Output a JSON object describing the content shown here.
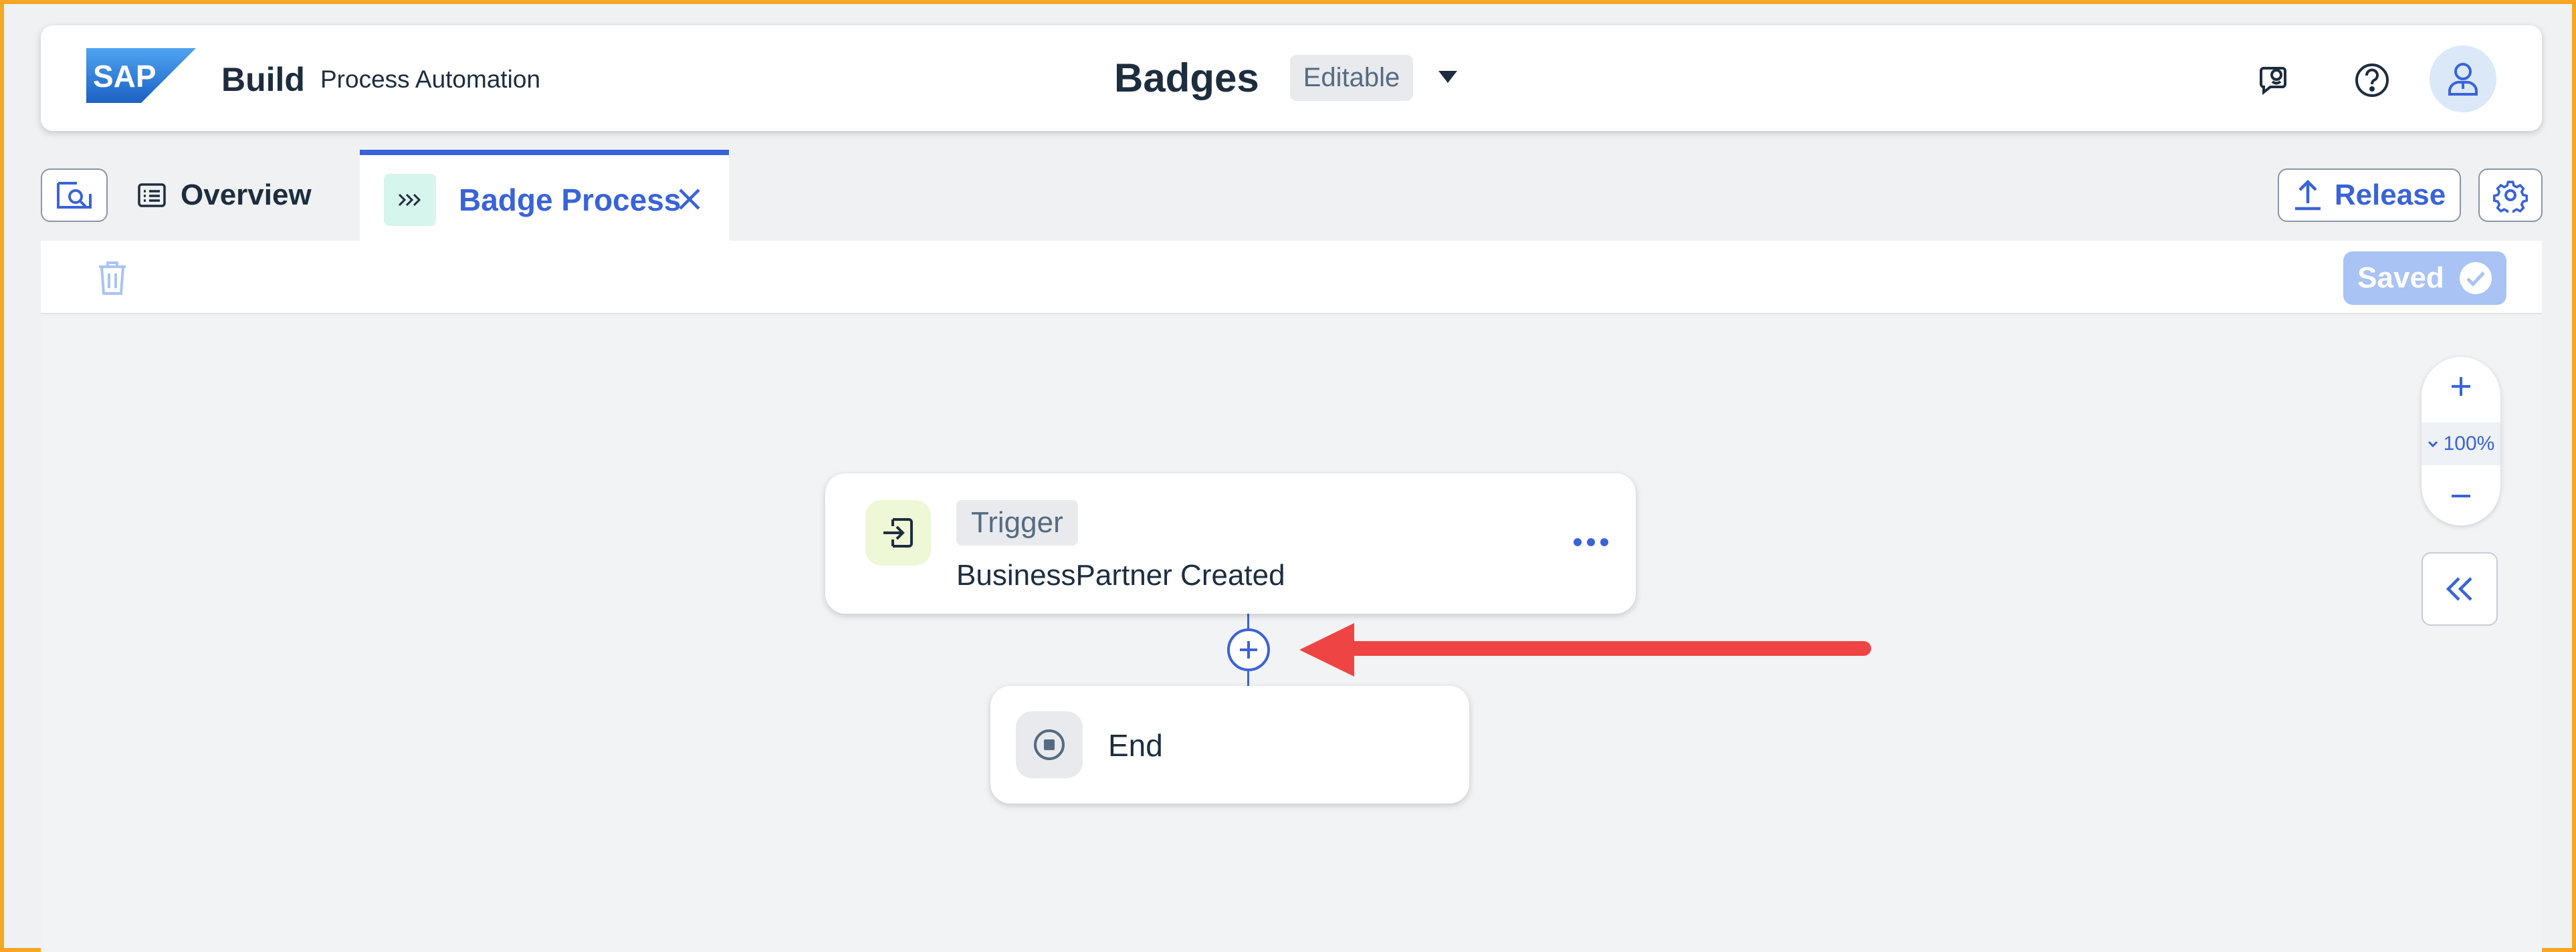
{
  "shellbar": {
    "logo_text": "SAP",
    "product": "Build",
    "subproduct": "Process Automation",
    "title": "Badges",
    "status_tag": "Editable",
    "icons": [
      "joule-assistant-icon",
      "help-icon",
      "user-avatar-icon"
    ]
  },
  "tabs": {
    "overview_label": "Overview",
    "active_label": "Badge Process"
  },
  "actions": {
    "release_label": "Release",
    "saved_label": "Saved"
  },
  "zoom": {
    "level": "100%"
  },
  "flow": {
    "trigger_tag": "Trigger",
    "trigger_name": "BusinessPartner Created",
    "end_label": "End"
  },
  "colors": {
    "accent": "#3a63d8",
    "annotation_arrow": "#ef4444",
    "frame_border": "#f5a623"
  }
}
